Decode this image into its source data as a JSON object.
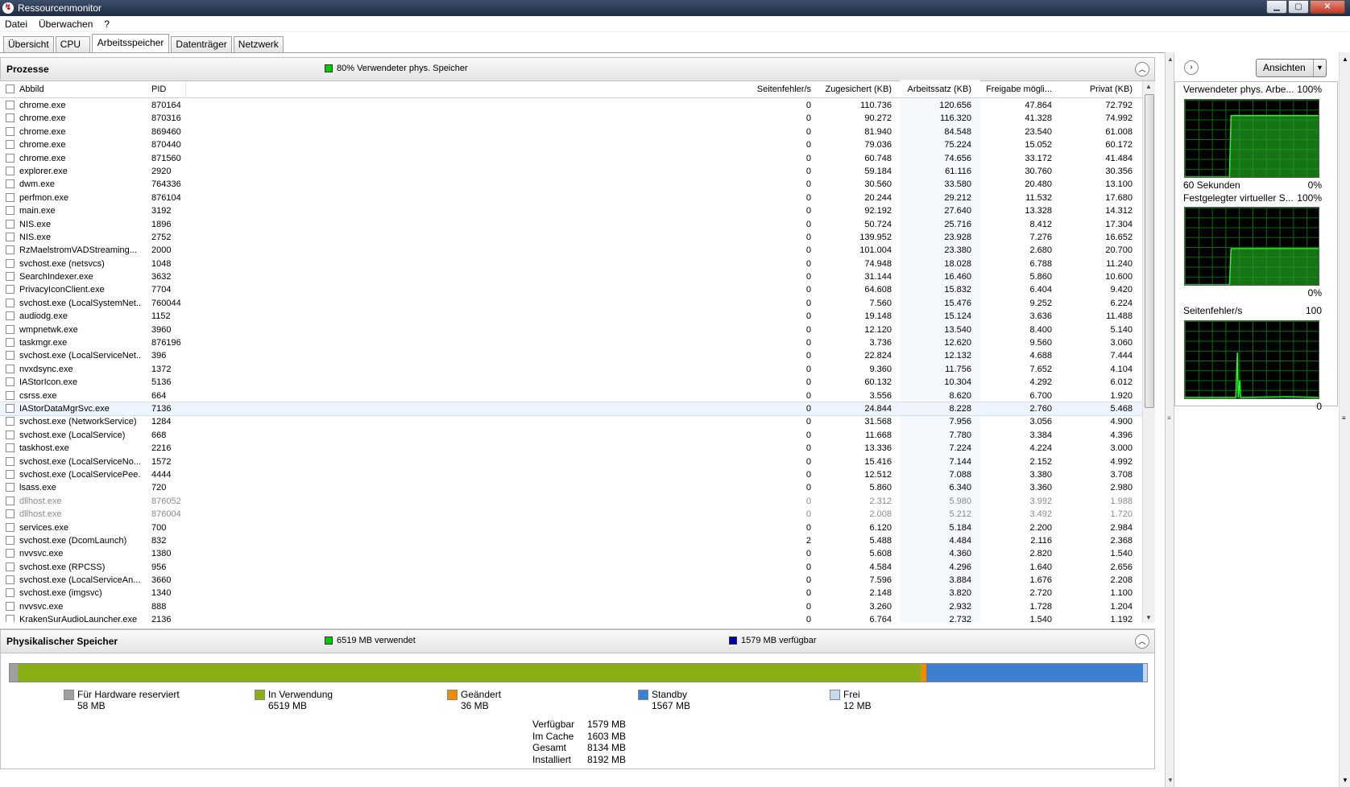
{
  "window": {
    "title": "Ressourcenmonitor"
  },
  "menu": [
    "Datei",
    "Überwachen",
    "?"
  ],
  "tabs": [
    "Übersicht",
    "CPU",
    "Arbeitsspeicher",
    "Datenträger",
    "Netzwerk"
  ],
  "processes": {
    "title": "Prozesse",
    "info": "80% Verwendeter phys. Speicher",
    "info_color": "#00cc00",
    "columns": [
      "Abbild",
      "PID",
      "Seitenfehler/s",
      "Zugesichert (KB)",
      "Arbeitssatz (KB)",
      "Freigabe mögli...",
      "Privat (KB)"
    ],
    "rows": [
      [
        "chrome.exe",
        "870164",
        "0",
        "110.736",
        "120.656",
        "47.864",
        "72.792"
      ],
      [
        "chrome.exe",
        "870316",
        "0",
        "90.272",
        "116.320",
        "41.328",
        "74.992"
      ],
      [
        "chrome.exe",
        "869460",
        "0",
        "81.940",
        "84.548",
        "23.540",
        "61.008"
      ],
      [
        "chrome.exe",
        "870440",
        "0",
        "79.036",
        "75.224",
        "15.052",
        "60.172"
      ],
      [
        "chrome.exe",
        "871560",
        "0",
        "60.748",
        "74.656",
        "33.172",
        "41.484"
      ],
      [
        "explorer.exe",
        "2920",
        "0",
        "59.184",
        "61.116",
        "30.760",
        "30.356"
      ],
      [
        "dwm.exe",
        "764336",
        "0",
        "30.560",
        "33.580",
        "20.480",
        "13.100"
      ],
      [
        "perfmon.exe",
        "876104",
        "0",
        "20.244",
        "29.212",
        "11.532",
        "17.680"
      ],
      [
        "main.exe",
        "3192",
        "0",
        "92.192",
        "27.640",
        "13.328",
        "14.312"
      ],
      [
        "NIS.exe",
        "1896",
        "0",
        "50.724",
        "25.716",
        "8.412",
        "17.304"
      ],
      [
        "NIS.exe",
        "2752",
        "0",
        "139.952",
        "23.928",
        "7.276",
        "16.652"
      ],
      [
        "RzMaelstromVADStreaming...",
        "2000",
        "0",
        "101.004",
        "23.380",
        "2.680",
        "20.700"
      ],
      [
        "svchost.exe (netsvcs)",
        "1048",
        "0",
        "74.948",
        "18.028",
        "6.788",
        "11.240"
      ],
      [
        "SearchIndexer.exe",
        "3632",
        "0",
        "31.144",
        "16.460",
        "5.860",
        "10.600"
      ],
      [
        "PrivacyIconClient.exe",
        "7704",
        "0",
        "64.608",
        "15.832",
        "6.404",
        "9.420"
      ],
      [
        "svchost.exe (LocalSystemNet...",
        "760044",
        "0",
        "7.560",
        "15.476",
        "9.252",
        "6.224"
      ],
      [
        "audiodg.exe",
        "1152",
        "0",
        "19.148",
        "15.124",
        "3.636",
        "11.488"
      ],
      [
        "wmpnetwk.exe",
        "3960",
        "0",
        "12.120",
        "13.540",
        "8.400",
        "5.140"
      ],
      [
        "taskmgr.exe",
        "876196",
        "0",
        "3.736",
        "12.620",
        "9.560",
        "3.060"
      ],
      [
        "svchost.exe (LocalServiceNet...",
        "396",
        "0",
        "22.824",
        "12.132",
        "4.688",
        "7.444"
      ],
      [
        "nvxdsync.exe",
        "1372",
        "0",
        "9.360",
        "11.756",
        "7.652",
        "4.104"
      ],
      [
        "IAStorIcon.exe",
        "5136",
        "0",
        "60.132",
        "10.304",
        "4.292",
        "6.012"
      ],
      [
        "csrss.exe",
        "664",
        "0",
        "3.556",
        "8.620",
        "6.700",
        "1.920"
      ],
      [
        "IAStorDataMgrSvc.exe",
        "7136",
        "0",
        "24.844",
        "8.228",
        "2.760",
        "5.468"
      ],
      [
        "svchost.exe (NetworkService)",
        "1284",
        "0",
        "31.568",
        "7.956",
        "3.056",
        "4.900"
      ],
      [
        "svchost.exe (LocalService)",
        "668",
        "0",
        "11.668",
        "7.780",
        "3.384",
        "4.396"
      ],
      [
        "taskhost.exe",
        "2216",
        "0",
        "13.336",
        "7.224",
        "4.224",
        "3.000"
      ],
      [
        "svchost.exe (LocalServiceNo...",
        "1572",
        "0",
        "15.416",
        "7.144",
        "2.152",
        "4.992"
      ],
      [
        "svchost.exe (LocalServicePee...",
        "4444",
        "0",
        "12.512",
        "7.088",
        "3.380",
        "3.708"
      ],
      [
        "lsass.exe",
        "720",
        "0",
        "5.860",
        "6.340",
        "3.360",
        "2.980"
      ],
      [
        "dllhost.exe",
        "876052",
        "0",
        "2.312",
        "5.980",
        "3.992",
        "1.988"
      ],
      [
        "dllhost.exe",
        "876004",
        "0",
        "2.008",
        "5.212",
        "3.492",
        "1.720"
      ],
      [
        "services.exe",
        "700",
        "0",
        "6.120",
        "5.184",
        "2.200",
        "2.984"
      ],
      [
        "svchost.exe (DcomLaunch)",
        "832",
        "2",
        "5.488",
        "4.484",
        "2.116",
        "2.368"
      ],
      [
        "nvvsvc.exe",
        "1380",
        "0",
        "5.608",
        "4.360",
        "2.820",
        "1.540"
      ],
      [
        "svchost.exe (RPCSS)",
        "956",
        "0",
        "4.584",
        "4.296",
        "1.640",
        "2.656"
      ],
      [
        "svchost.exe (LocalServiceAn...",
        "3660",
        "0",
        "7.596",
        "3.884",
        "1.676",
        "2.208"
      ],
      [
        "svchost.exe (imgsvc)",
        "1340",
        "0",
        "2.148",
        "3.820",
        "2.720",
        "1.100"
      ],
      [
        "nvvsvc.exe",
        "888",
        "0",
        "3.260",
        "2.932",
        "1.728",
        "1.204"
      ],
      [
        "KrakenSurAudioLauncher.exe",
        "2136",
        "0",
        "6.764",
        "2.732",
        "1.540",
        "1.192"
      ]
    ],
    "selected_row": 23,
    "dim_rows": [
      30,
      31
    ]
  },
  "physical": {
    "title": "Physikalischer Speicher",
    "used_label": "6519 MB verwendet",
    "used_color": "#00cc00",
    "avail_label": "1579 MB verfügbar",
    "avail_color": "#0000aa",
    "segments": [
      {
        "name": "Für Hardware reserviert",
        "value": "58 MB",
        "mb": 58,
        "color": "#a0a0a0"
      },
      {
        "name": "In Verwendung",
        "value": "6519 MB",
        "mb": 6519,
        "color": "#8aaf14"
      },
      {
        "name": "Geändert",
        "value": "36 MB",
        "mb": 36,
        "color": "#f08c00"
      },
      {
        "name": "Standby",
        "value": "1567 MB",
        "mb": 1567,
        "color": "#3d7fd0"
      },
      {
        "name": "Frei",
        "value": "12 MB",
        "mb": 12,
        "color": "#c6d9f1"
      }
    ],
    "totals": [
      {
        "k": "Verfügbar",
        "v": "1579 MB"
      },
      {
        "k": "Im Cache",
        "v": "1603 MB"
      },
      {
        "k": "Gesamt",
        "v": "8134 MB"
      },
      {
        "k": "Installiert",
        "v": "8192 MB"
      }
    ]
  },
  "side": {
    "button": "Ansichten",
    "graphs": [
      {
        "label": "Verwendeter phys. Arbe...",
        "max": "100%",
        "min": "0%",
        "foot": "60 Sekunden"
      },
      {
        "label": "Festgelegter virtueller S...",
        "max": "100%",
        "min": "0%",
        "foot": ""
      },
      {
        "label": "Seitenfehler/s",
        "max": "100",
        "min": "0",
        "foot": ""
      }
    ],
    "graph_colors": {
      "background": "#000000",
      "grid": "#0a6e0a",
      "line": "#22ff22",
      "fill": "#1fa51f"
    }
  }
}
